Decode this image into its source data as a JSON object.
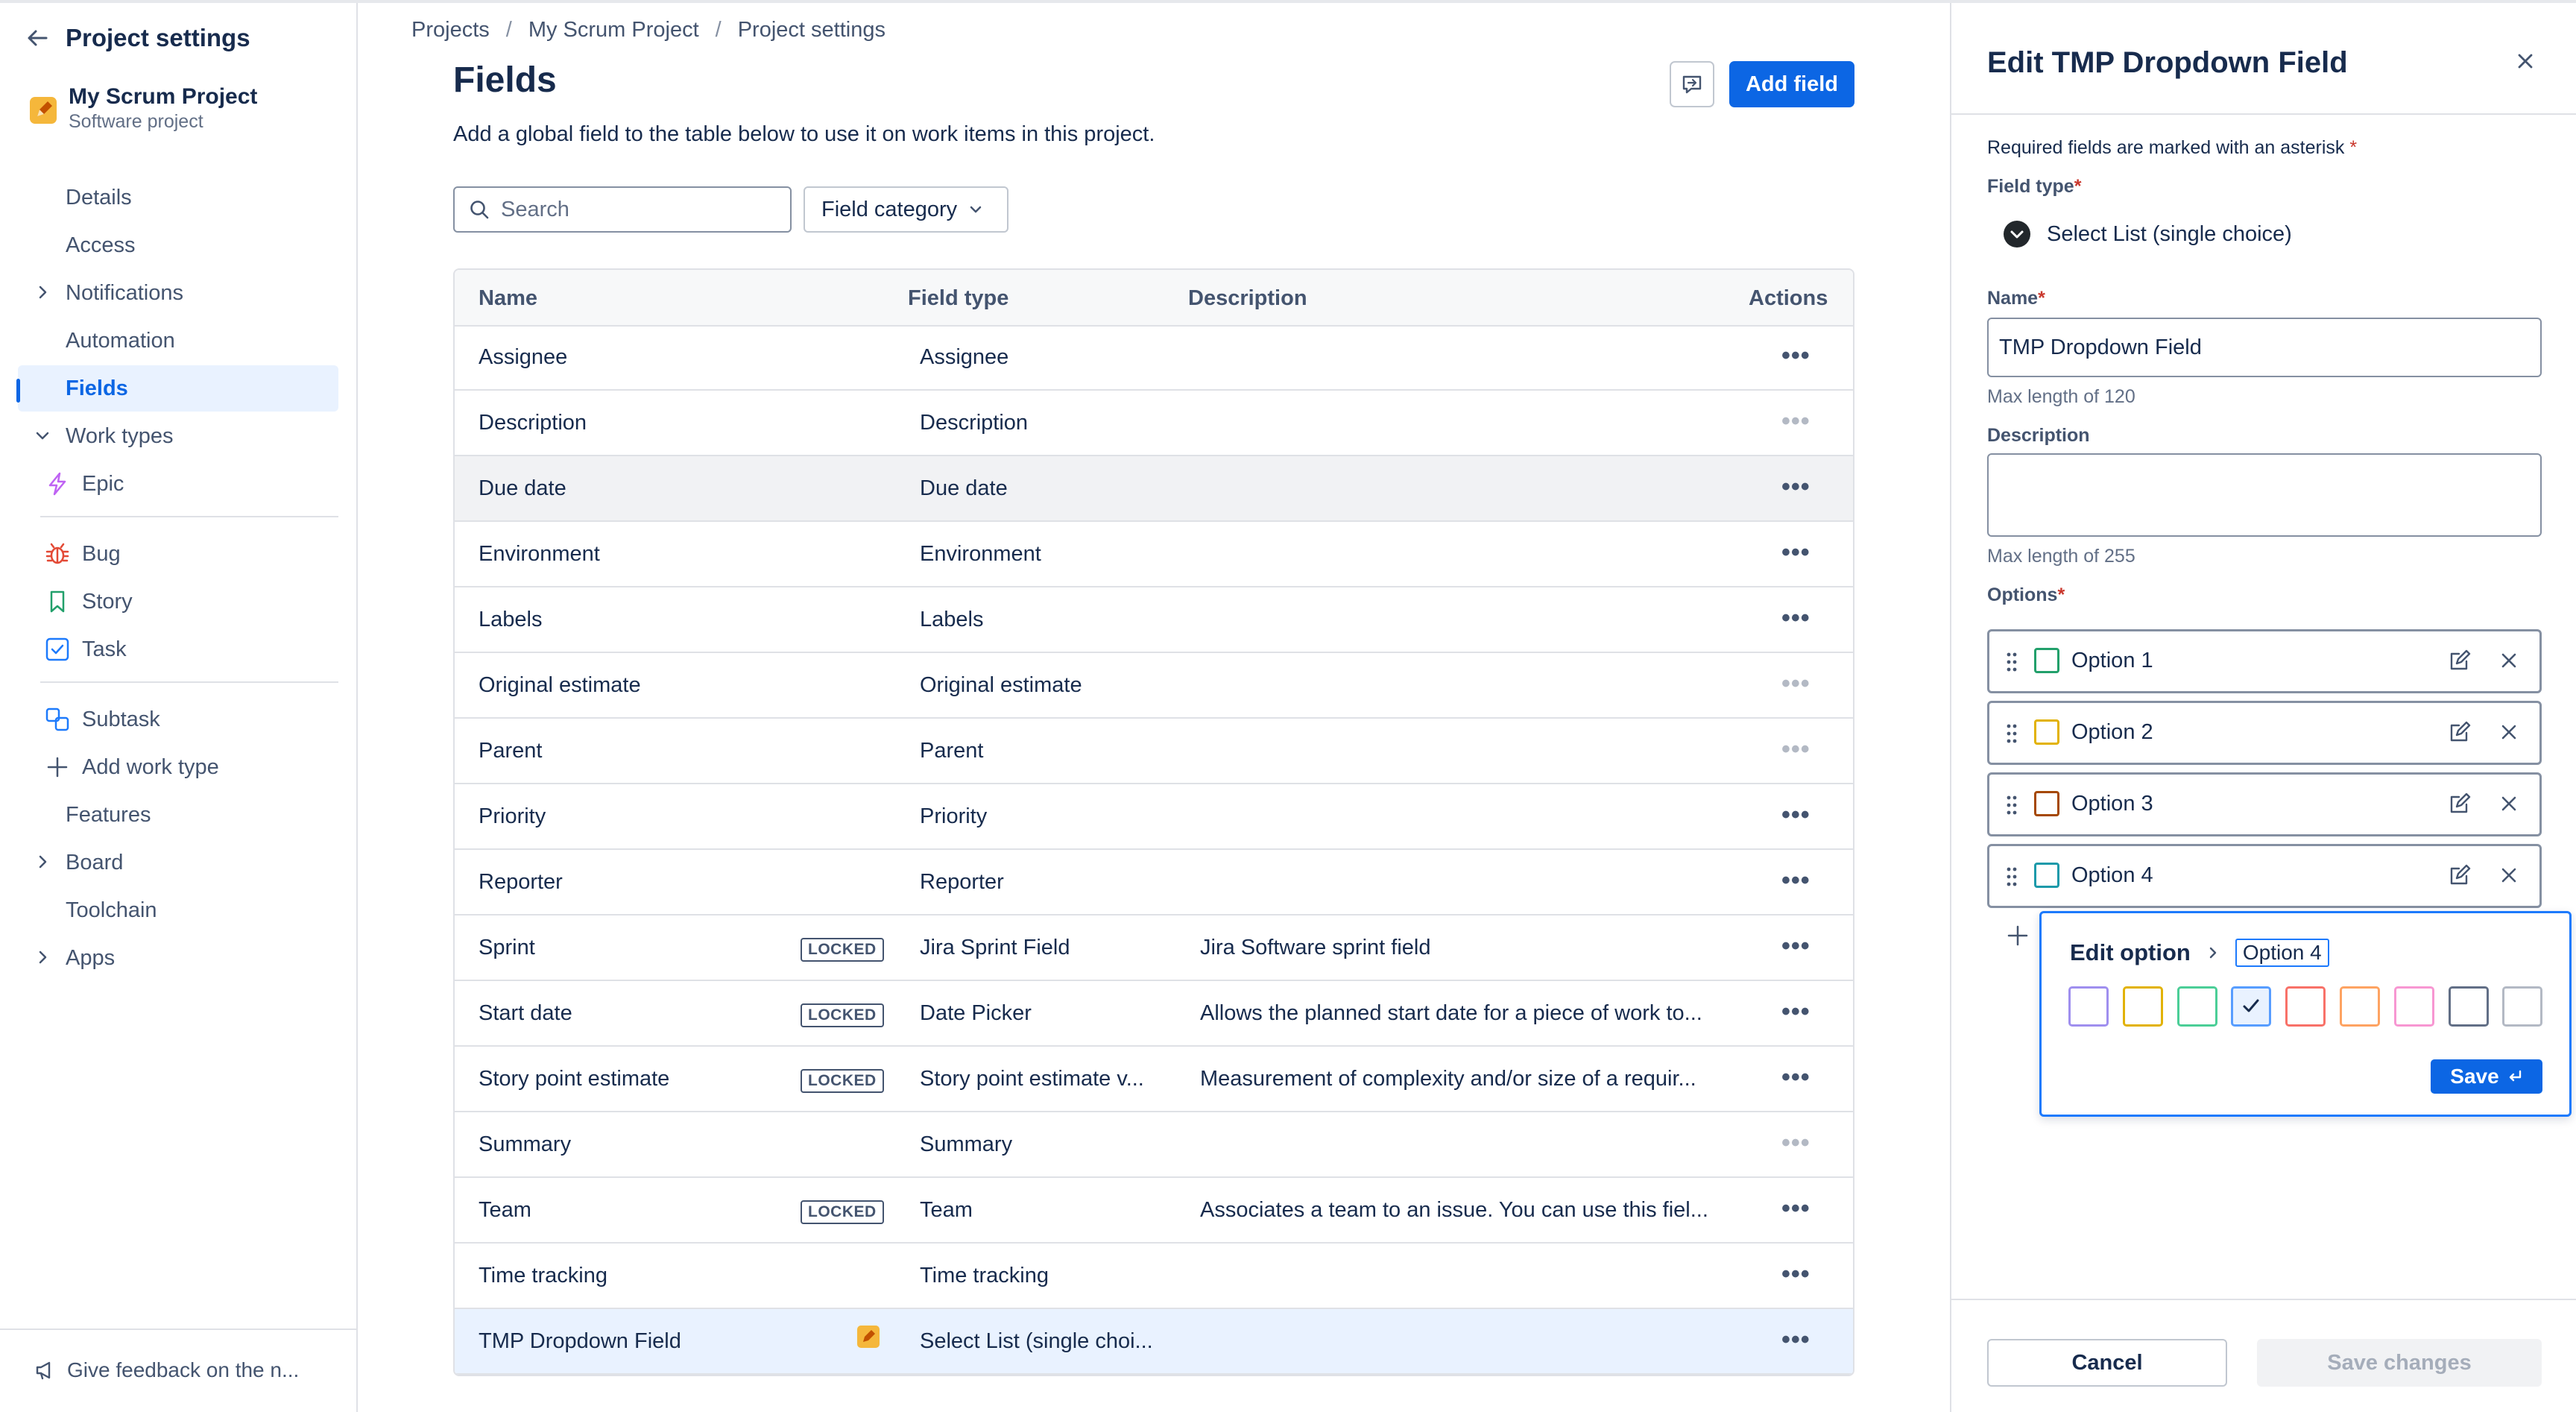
{
  "sidebar": {
    "title": "Project settings",
    "project_name": "My Scrum Project",
    "project_type": "Software project",
    "items": [
      {
        "label": "Details"
      },
      {
        "label": "Access"
      },
      {
        "label": "Notifications"
      },
      {
        "label": "Automation"
      },
      {
        "label": "Fields"
      },
      {
        "label": "Work types"
      }
    ],
    "work_types": [
      {
        "label": "Epic",
        "icon": "lightning-icon"
      },
      {
        "label": "Bug",
        "icon": "bug-icon"
      },
      {
        "label": "Story",
        "icon": "bookmark-icon"
      },
      {
        "label": "Task",
        "icon": "checkbox-icon"
      },
      {
        "label": "Subtask",
        "icon": "subtask-icon"
      },
      {
        "label": "Add work type",
        "icon": "plus-icon"
      }
    ],
    "more_items": [
      {
        "label": "Features"
      },
      {
        "label": "Board"
      },
      {
        "label": "Toolchain"
      },
      {
        "label": "Apps"
      }
    ],
    "feedback": "Give feedback on the n..."
  },
  "breadcrumb": [
    "Projects",
    "My Scrum Project",
    "Project settings"
  ],
  "main": {
    "title": "Fields",
    "description": "Add a global field to the table below to use it on work items in this project.",
    "add_field": "Add field",
    "search_placeholder": "Search",
    "category": "Field category",
    "columns": [
      "Name",
      "Field type",
      "Description",
      "Actions"
    ],
    "locked_label": "LOCKED",
    "rows": [
      {
        "name": "Assignee",
        "type": "Assignee",
        "desc": ""
      },
      {
        "name": "Description",
        "type": "Description",
        "desc": ""
      },
      {
        "name": "Due date",
        "type": "Due date",
        "desc": ""
      },
      {
        "name": "Environment",
        "type": "Environment",
        "desc": ""
      },
      {
        "name": "Labels",
        "type": "Labels",
        "desc": ""
      },
      {
        "name": "Original estimate",
        "type": "Original estimate",
        "desc": ""
      },
      {
        "name": "Parent",
        "type": "Parent",
        "desc": ""
      },
      {
        "name": "Priority",
        "type": "Priority",
        "desc": ""
      },
      {
        "name": "Reporter",
        "type": "Reporter",
        "desc": ""
      },
      {
        "name": "Sprint",
        "type": "Jira Sprint Field",
        "desc": "Jira Software sprint field"
      },
      {
        "name": "Start date",
        "type": "Date Picker",
        "desc": "Allows the planned start date for a piece of work to..."
      },
      {
        "name": "Story point estimate",
        "type": "Story point estimate v...",
        "desc": "Measurement of complexity and/or size of a requir..."
      },
      {
        "name": "Summary",
        "type": "Summary",
        "desc": ""
      },
      {
        "name": "Team",
        "type": "Team",
        "desc": "Associates a team to an issue. You can use this fiel..."
      },
      {
        "name": "Time tracking",
        "type": "Time tracking",
        "desc": ""
      },
      {
        "name": "TMP Dropdown Field",
        "type": "Select List (single choi...",
        "desc": ""
      }
    ]
  },
  "panel": {
    "title": "Edit TMP Dropdown Field",
    "required_note": "Required fields are marked with an asterisk",
    "asterisk": "*",
    "field_type_label": "Field type",
    "field_type_value": "Select List (single choice)",
    "name_label": "Name",
    "name_value": "TMP Dropdown Field",
    "name_hint": "Max length of 120",
    "description_label": "Description",
    "description_value": "",
    "description_hint": "Max length of 255",
    "options_label": "Options",
    "options": [
      {
        "label": "Option 1",
        "color": "#22a06b"
      },
      {
        "label": "Option 2",
        "color": "#e2b203"
      },
      {
        "label": "Option 3",
        "color": "#a54800"
      },
      {
        "label": "Option 4",
        "color": "#1d9aaa"
      }
    ],
    "edit_option": {
      "title": "Edit option",
      "chip": "Option 4",
      "save": "Save",
      "swatches": [
        "#9f8fef",
        "#e2b203",
        "#4bce97",
        "#579dff",
        "#f87168",
        "#fea362",
        "#f797d2",
        "#626f86",
        "#b3b9c4"
      ],
      "selected_index": 3
    },
    "cancel": "Cancel",
    "save_changes": "Save changes"
  }
}
